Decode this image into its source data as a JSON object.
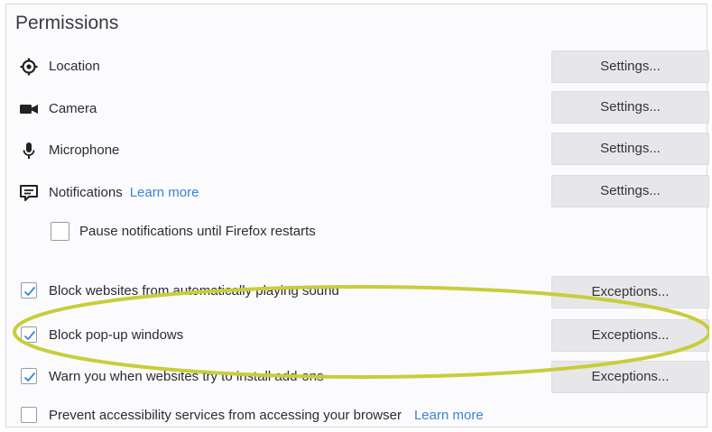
{
  "section": {
    "title": "Permissions"
  },
  "permissions": [
    {
      "label": "Location",
      "button": "Settings...",
      "icon": "location-icon"
    },
    {
      "label": "Camera",
      "button": "Settings...",
      "icon": "camera-icon"
    },
    {
      "label": "Microphone",
      "button": "Settings...",
      "icon": "microphone-icon"
    },
    {
      "label": "Notifications",
      "link": "Learn more",
      "button": "Settings...",
      "icon": "notifications-icon"
    }
  ],
  "pause_notifications": {
    "label": "Pause notifications until Firefox restarts",
    "checked": false
  },
  "blocking": [
    {
      "label": "Block websites from automatically playing sound",
      "button": "Exceptions...",
      "checked": true
    },
    {
      "label": "Block pop-up windows",
      "button": "Exceptions...",
      "checked": true
    },
    {
      "label": "Warn you when websites try to install add-ons",
      "button": "Exceptions...",
      "checked": true
    }
  ],
  "accessibility": {
    "label": "Prevent accessibility services from accessing your browser",
    "link": "Learn more",
    "checked": false
  },
  "colors": {
    "highlight": "#c8cd3c",
    "link": "#3b82d8",
    "check": "#3b82d8"
  }
}
